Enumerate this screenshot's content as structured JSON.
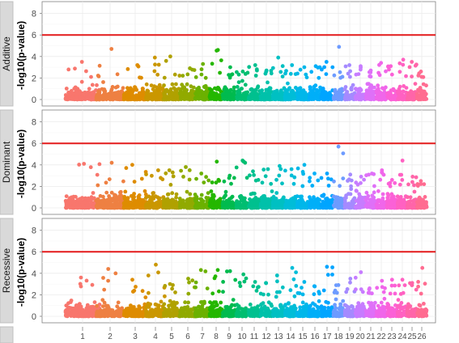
{
  "chart_data": {
    "type": "scatter",
    "subtype": "manhattan",
    "y_label": "-log10(p-value)",
    "y_ticks": [
      0,
      2,
      4,
      6,
      8
    ],
    "ylim": [
      0,
      8.5
    ],
    "threshold": 6,
    "threshold_color": "#e31a1c",
    "chromosomes": [
      "1",
      "2",
      "3",
      "4",
      "5",
      "6",
      "7",
      "8",
      "9",
      "10",
      "11",
      "12",
      "13",
      "14",
      "15",
      "16",
      "17",
      "18",
      "19",
      "20",
      "21",
      "22",
      "23",
      "24",
      "25",
      "26"
    ],
    "chromosome_colors": [
      "#F8766D",
      "#EE8042",
      "#DE8C00",
      "#CA9700",
      "#B0A100",
      "#91AA00",
      "#6BB100",
      "#24B700",
      "#00BB4E",
      "#00BE71",
      "#00C08F",
      "#00C1AA",
      "#00C0C2",
      "#00BDD8",
      "#00B7EA",
      "#00AFF8",
      "#00A5FF",
      "#6D9BFF",
      "#A58AFF",
      "#C77CFF",
      "#DF70F8",
      "#F066EA",
      "#FB61D7",
      "#FF61C2",
      "#FF65A9",
      "#FF6C91"
    ],
    "panels": [
      {
        "label": "Additive",
        "chrom_max": [
          3.5,
          4.7,
          3.2,
          3.9,
          4.0,
          2.9,
          3.3,
          4.6,
          3.0,
          2.6,
          3.2,
          2.7,
          3.9,
          3.2,
          3.0,
          3.1,
          3.5,
          4.9,
          3.2,
          3.1,
          2.7,
          3.4,
          3.1,
          3.7,
          3.5,
          2.6
        ]
      },
      {
        "label": "Dominant",
        "chrom_max": [
          4.1,
          4.2,
          4.0,
          3.5,
          3.5,
          3.8,
          3.2,
          4.3,
          3.0,
          4.4,
          3.4,
          3.6,
          3.9,
          3.6,
          4.0,
          3.2,
          3.2,
          5.7,
          3.1,
          2.9,
          3.2,
          3.5,
          2.6,
          4.4,
          2.9,
          2.5
        ]
      },
      {
        "label": "Recessive",
        "chrom_max": [
          3.6,
          4.4,
          3.4,
          4.8,
          3.0,
          3.5,
          4.3,
          4.3,
          4.2,
          3.9,
          3.2,
          3.1,
          3.8,
          4.5,
          3.2,
          2.8,
          4.6,
          2.9,
          3.5,
          4.1,
          2.6,
          3.3,
          3.4,
          3.4,
          3.1,
          4.5
        ]
      }
    ]
  }
}
